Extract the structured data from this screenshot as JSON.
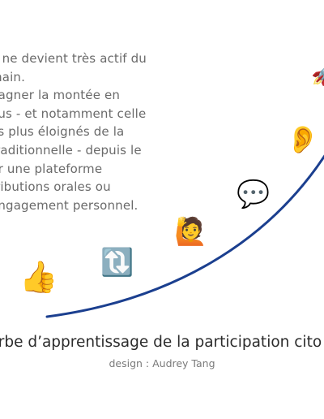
{
  "description_lines": [
    "n ne devient très actif du",
    "main.",
    "pagner la montée en",
    "ous - et notamment celle",
    "es plus éloignés de la",
    "traditionnelle - depuis le",
    "ur une plateforme",
    "tributions orales ou",
    "engagement personnel."
  ],
  "curve_color": "#1b3f8f",
  "icons": [
    {
      "name": "thumbs-up-icon",
      "glyph": "👍"
    },
    {
      "name": "retweet-icon",
      "glyph": "🔃"
    },
    {
      "name": "raising-hand-icon",
      "glyph": "🙋"
    },
    {
      "name": "speech-bubble-icon",
      "glyph": "💬"
    },
    {
      "name": "ear-icon",
      "glyph": "👂"
    },
    {
      "name": "rocket-icon",
      "glyph": "🚀"
    }
  ],
  "caption": {
    "title": "urbe d’apprentissage de la participation cito",
    "credit": "design : Audrey Tang"
  }
}
